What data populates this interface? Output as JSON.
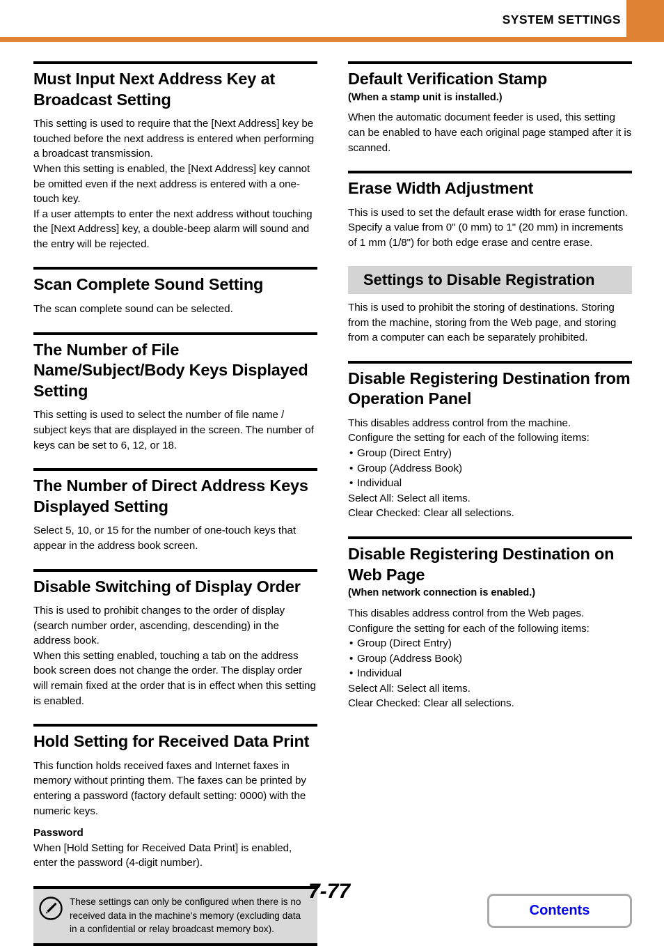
{
  "header": {
    "title": "SYSTEM SETTINGS",
    "accent_color": "#E08234"
  },
  "left_column": {
    "sections": [
      {
        "heading": "Must Input Next Address Key at Broadcast Setting",
        "paragraphs": [
          "This setting is used to require that the [Next Address] key be touched before the next address is entered when performing a broadcast transmission.",
          "When this setting is enabled, the [Next Address] key cannot be omitted even if the next address is entered with a one-touch key.",
          "If a user attempts to enter the next address without touching the [Next Address] key, a double-beep alarm will sound and the entry will be rejected."
        ]
      },
      {
        "heading": "Scan Complete Sound Setting",
        "paragraphs": [
          "The scan complete sound can be selected."
        ]
      },
      {
        "heading": "The Number of File Name/Subject/Body Keys Displayed Setting",
        "paragraphs": [
          "This setting is used to select the number of file name / subject keys that are displayed in the screen. The number of keys can be set to 6, 12, or 18."
        ]
      },
      {
        "heading": "The Number of Direct Address Keys Displayed Setting",
        "paragraphs": [
          "Select 5, 10, or 15 for the number of one-touch keys that appear in the address book screen."
        ]
      },
      {
        "heading": "Disable Switching of Display Order",
        "paragraphs": [
          "This is used to prohibit changes to the order of display (search number order, ascending, descending) in the address book.",
          "When this setting enabled, touching a tab on the address book screen does not change the order. The display order will remain fixed at the order that is in effect when this setting is enabled."
        ]
      },
      {
        "heading": "Hold Setting for Received Data Print",
        "paragraphs": [
          "This function holds received faxes and Internet faxes in memory without printing them. The faxes can be printed by entering a password (factory default setting: 0000) with the numeric keys."
        ],
        "bold_label": "Password",
        "after_label_paragraph": "When [Hold Setting for Received Data Print] is enabled, enter the password (4-digit number)."
      }
    ],
    "note": {
      "icon": "note-pencil-icon",
      "text": "These settings can only be configured when there is no received data in the machine's memory (excluding data in a confidential or relay broadcast memory box)."
    }
  },
  "right_column": {
    "sections": [
      {
        "heading": "Default Verification Stamp",
        "subheading": "(When a stamp unit is installed.)",
        "paragraphs": [
          "When the automatic document feeder is used, this setting can be enabled to have each original page stamped after it is scanned."
        ]
      },
      {
        "heading": "Erase Width Adjustment",
        "paragraphs": [
          "This is used to set the default erase width for erase function. Specify a value from 0\" (0 mm) to 1\" (20 mm) in increments of 1 mm (1/8\") for both edge erase and centre erase."
        ]
      },
      {
        "banner_heading": "Settings to Disable Registration",
        "paragraphs": [
          "This is used to prohibit the storing of destinations. Storing from the machine, storing from the Web page, and storing from a computer can each be separately prohibited."
        ]
      },
      {
        "heading": "Disable Registering Destination from Operation Panel",
        "paragraphs": [
          "This disables address control from the machine.",
          "Configure the setting for each of the following items:"
        ],
        "bullets": [
          "Group (Direct Entry)",
          "Group (Address Book)",
          "Individual"
        ],
        "trailing_lines": [
          "Select All: Select all items.",
          "Clear Checked: Clear all selections."
        ]
      },
      {
        "heading": "Disable Registering Destination on Web Page",
        "subheading": "(When network connection is enabled.)",
        "paragraphs": [
          "This disables address control from the Web pages.",
          "Configure the setting for each of the following items:"
        ],
        "bullets": [
          "Group (Direct Entry)",
          "Group (Address Book)",
          "Individual"
        ],
        "trailing_lines": [
          "Select All: Select all items.",
          "Clear Checked: Clear all selections."
        ]
      }
    ]
  },
  "footer": {
    "page_number": "7-77",
    "contents_label": "Contents",
    "contents_color": "#0000EE"
  }
}
